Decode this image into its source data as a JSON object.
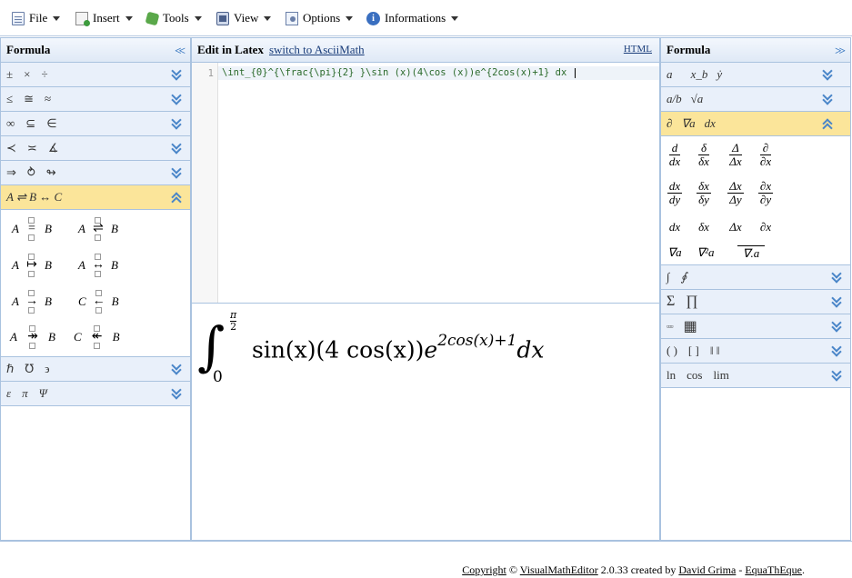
{
  "menu": {
    "file": "File",
    "insert": "Insert",
    "tools": "Tools",
    "view": "View",
    "options": "Options",
    "informations": "Informations"
  },
  "left_panel": {
    "title": "Formula",
    "rows": [
      {
        "symbols": [
          "±",
          "×",
          "÷"
        ]
      },
      {
        "symbols": [
          "≤",
          "≅",
          "≈"
        ]
      },
      {
        "symbols": [
          "∞",
          "⊆",
          "∈"
        ]
      },
      {
        "symbols": [
          "≺",
          "≍",
          "∡"
        ]
      },
      {
        "symbols": [
          "⇒",
          "⥁",
          "↬"
        ]
      },
      {
        "label": "A ⇌ B ↔ C"
      }
    ],
    "arrows": [
      {
        "left": "A",
        "glyph": "=",
        "right": "B"
      },
      {
        "left": "A",
        "glyph": "⇌",
        "right": "B"
      },
      {
        "left": "A",
        "glyph": "↦",
        "right": "B"
      },
      {
        "left": "A",
        "glyph": "↔",
        "right": "B"
      },
      {
        "left": "A",
        "glyph": "→",
        "right": "B"
      },
      {
        "left": "C",
        "glyph": "←",
        "right": "B"
      },
      {
        "left": "A",
        "glyph": "↠",
        "right": "B"
      },
      {
        "left": "C",
        "glyph": "↞",
        "right": "B"
      }
    ],
    "rows_after": [
      {
        "symbols": [
          "ℏ",
          "℧",
          "϶"
        ]
      },
      {
        "symbols": [
          "ε",
          "π",
          "Ψ"
        ]
      }
    ]
  },
  "editor": {
    "title": "Edit in Latex",
    "switch_link": "switch to AsciiMath",
    "html_link": "HTML",
    "line_number": "1",
    "latex_code": "\\int_{0}^{\\frac{\\pi}{2} }\\sin (x)(4\\cos (x))e^{2cos(x)+1} dx "
  },
  "preview": {
    "integral_sign": "∫",
    "upper_num": "π",
    "upper_den": "2",
    "lower": "0",
    "expr_main": "sin(x)(4 cos(x))",
    "expr_e": "e",
    "expr_sup": "2cos(x)+1",
    "expr_tail": "dx"
  },
  "right_panel": {
    "title": "Formula",
    "rows_before": [
      {
        "symbols": [
          "a⃗",
          "x_b",
          "ẏ"
        ]
      },
      {
        "symbols": [
          "a/b",
          "√a"
        ]
      },
      {
        "symbols": [
          "∂",
          "∇a",
          "dx"
        ]
      }
    ],
    "derivatives": [
      {
        "num": "d",
        "den": "dx"
      },
      {
        "num": "δ",
        "den": "δx"
      },
      {
        "num": "Δ",
        "den": "Δx"
      },
      {
        "num": "∂",
        "den": "∂x"
      },
      {
        "num": "dx",
        "den": "dy"
      },
      {
        "num": "δx",
        "den": "δy"
      },
      {
        "num": "Δx",
        "den": "Δy"
      },
      {
        "num": "∂x",
        "den": "∂y"
      }
    ],
    "plain_derivs": [
      "dx",
      "δx",
      "Δx",
      "∂x"
    ],
    "nabla_row": [
      "∇a",
      "∇²a",
      "∇.a"
    ],
    "rows_after": [
      {
        "symbols": [
          "∫",
          "∮"
        ]
      },
      {
        "symbols": [
          "Σ",
          "∏"
        ]
      },
      {
        "symbols": [
          "▫▫▫",
          "▦"
        ]
      },
      {
        "symbols": [
          "( )",
          "[ ]",
          "‖ ‖"
        ]
      },
      {
        "symbols": [
          "ln",
          "cos",
          "lim"
        ]
      }
    ]
  },
  "footer": {
    "copyright": "Copyright",
    "symbol": "©",
    "app": "VisualMathEditor",
    "version": "2.0.33 created by",
    "author": "David Grima",
    "separator": "-",
    "site": "EquaThEque",
    "end": "."
  }
}
